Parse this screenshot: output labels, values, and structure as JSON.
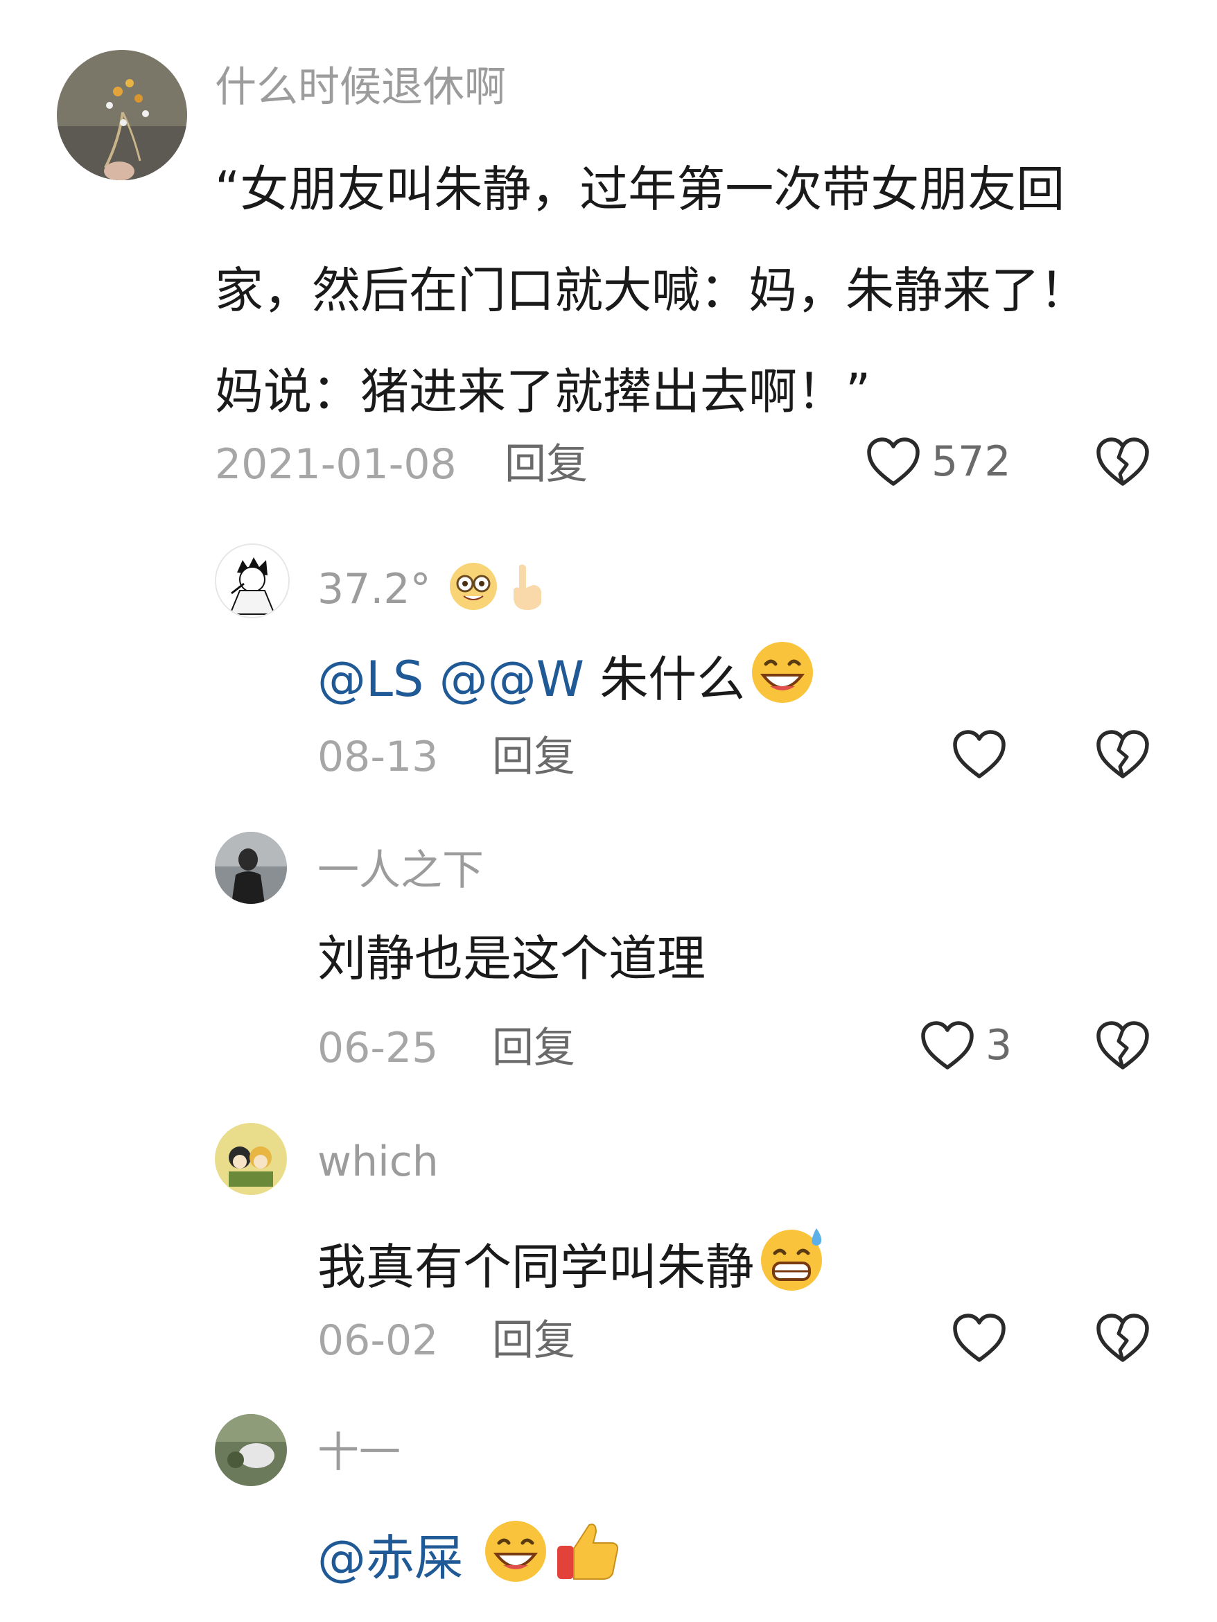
{
  "main_comment": {
    "username": "什么时候退休啊",
    "lines": [
      "“女朋友叫朱静，过年第一次带女朋友回",
      "家，然后在门口就大喊：妈，朱静来了！",
      "妈说：猪进来了就撵出去啊！”"
    ],
    "date": "2021-01-08",
    "reply_label": "回复",
    "like_count": "572"
  },
  "replies": [
    {
      "username": "37.2°",
      "mention1": "@LS",
      "mention2": "@@W",
      "text": "朱什么",
      "date": "08-13",
      "reply_label": "回复"
    },
    {
      "username": "一人之下",
      "text": "刘静也是这个道理",
      "date": "06-25",
      "reply_label": "回复",
      "like_count": "3"
    },
    {
      "username": "which",
      "text": "我真有个同学叫朱静",
      "date": "06-02",
      "reply_label": "回复"
    },
    {
      "username": "十一",
      "mention": "@赤屎"
    }
  ],
  "icons": {
    "like": "heart-outline-icon",
    "dislike": "broken-heart-icon",
    "emoji_glasses": "nerd-face-emoji",
    "emoji_point": "pointing-down-hand-emoji",
    "emoji_grin": "grinning-squinting-face-emoji",
    "emoji_sweat": "grimacing-sweat-face-emoji",
    "emoji_thumb": "thumbs-up-emoji"
  },
  "colors": {
    "mention": "#1f5a96",
    "username": "#9c9c9c",
    "meta": "#a6a6a6"
  }
}
